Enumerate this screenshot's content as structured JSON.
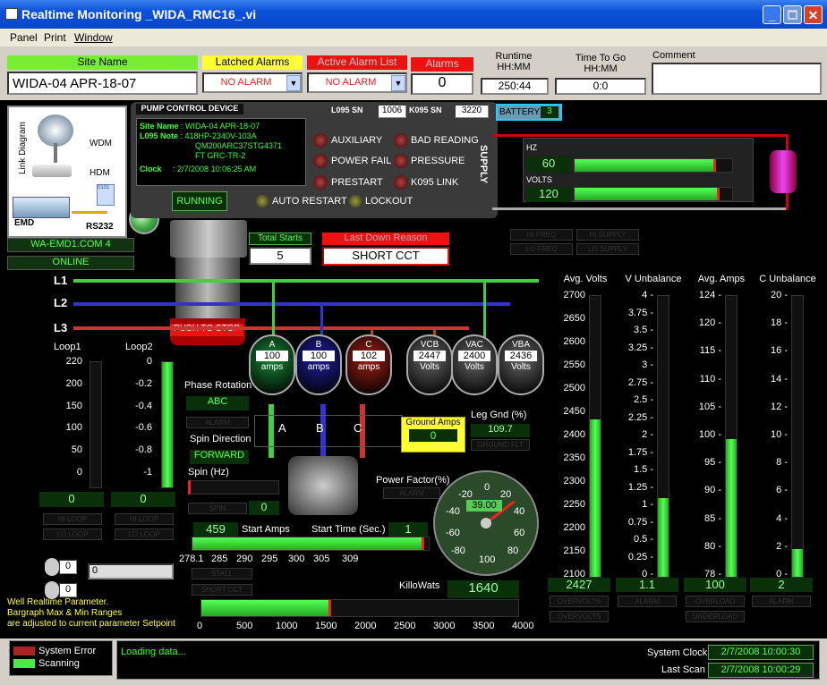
{
  "window": {
    "title": "Realtime Monitoring _WIDA_RMC16_.vi"
  },
  "menu": [
    "Panel",
    "Print",
    "Window"
  ],
  "top": {
    "site_name_label": "Site Name",
    "site_name_value": "WIDA-04    APR-18-07",
    "latched_alarms_label": "Latched Alarms",
    "latched_alarms_value": "NO ALARM",
    "active_alarm_label": "Active Alarm List",
    "active_alarm_value": "NO ALARM",
    "alarms_label": "Alarms",
    "alarms_value": "0",
    "runtime_label1": "Runtime",
    "runtime_label2": "HH:MM",
    "runtime_value": "250:44",
    "ttg_label1": "Time To Go",
    "ttg_label2": "HH:MM",
    "ttg_value": "0:0",
    "comment_label": "Comment",
    "comment_value": ""
  },
  "link": {
    "title": "Link Diagram",
    "wdm": "WDM",
    "hdm": "HDM",
    "emd": "EMD",
    "rs232": "RS232",
    "com": "WA-EMD1.COM 4",
    "status": "ONLINE"
  },
  "pcd": {
    "title": "PUMP CONTROL DEVICE",
    "l095_sn_label": "L095 SN",
    "l095_sn": "1006",
    "k095_sn_label": "K095 SN",
    "k095_sn": "3220",
    "battery_label": "BATTERY",
    "battery_value": "3",
    "site_name_label": "Site Name",
    "site_name": "WIDA-04   APR-18-07",
    "note_label": "L095 Note",
    "note": [
      "418HP-2340V-103A",
      "QM200ARC37STG4371",
      "FT GRC-TR-2"
    ],
    "clock_label": "Clock",
    "clock": "2/7/2008 10:06:25 AM",
    "indicators": [
      "AUXILIARY",
      "BAD READING",
      "POWER FAIL",
      "PRESSURE",
      "PRESTART",
      "K095 LINK"
    ],
    "supply": "SUPPLY",
    "running": "RUNNING",
    "auto_restart": "AUTO RESTART",
    "lockout": "LOCKOUT"
  },
  "supply": {
    "hz_label": "HZ",
    "hz": "60",
    "hz_frac": 0.9,
    "volts_label": "VOLTS",
    "volts": "120",
    "volts_frac": 0.92,
    "btns": [
      "HI FREQ",
      "HI SUPPLY",
      "LO FREQ",
      "LO SUPPLY"
    ]
  },
  "starts": {
    "total_label": "Total Starts",
    "total": "5",
    "down_label": "Last Down Reason",
    "down": "SHORT CCT",
    "push": "PUSH TO STOP"
  },
  "lines": [
    "L1",
    "L2",
    "L3"
  ],
  "meters": [
    {
      "name": "A",
      "value": "100",
      "unit": "amps",
      "color": "#1a8a3a"
    },
    {
      "name": "B",
      "value": "100",
      "unit": "amps",
      "color": "#2020a0"
    },
    {
      "name": "C",
      "value": "102",
      "unit": "amps",
      "color": "#a02018"
    },
    {
      "name": "VCB",
      "value": "2447",
      "unit": "Volts",
      "color": "#666"
    },
    {
      "name": "VAC",
      "value": "2400",
      "unit": "Volts",
      "color": "#666"
    },
    {
      "name": "VBA",
      "value": "2436",
      "unit": "Volts",
      "color": "#666"
    }
  ],
  "loops": {
    "loop1_label": "Loop1",
    "loop1_ticks": [
      "220",
      "200",
      "150",
      "100",
      "50",
      "0"
    ],
    "loop1_value": "0",
    "loop1_frac": 0,
    "loop2_label": "Loop2",
    "loop2_ticks": [
      "0",
      "-0.2",
      "-0.4",
      "-0.6",
      "-0.8",
      "-1"
    ],
    "loop2_value": "0",
    "loop2_frac": 1,
    "btns": [
      "HI LOOP",
      "HI LOOP",
      "LO LOOP",
      "LO LOOP"
    ]
  },
  "phase": {
    "rot_label": "Phase Rotation",
    "rot": "ABC",
    "alarm": "ALARM",
    "spin_dir_label": "Spin Direction",
    "spin_dir": "FORWARD",
    "spin_hz_label": "Spin (Hz)",
    "spin_btn": "SPIN",
    "spin_val": "0",
    "abc": [
      "A",
      "B",
      "C"
    ]
  },
  "ground": {
    "label": "Ground Amps",
    "value": "0",
    "leg_label": "Leg Gnd (%)",
    "leg": "109.7",
    "fault": "GROUND FLT"
  },
  "pf": {
    "label": "Power Factor(%)",
    "alarm": "ALARM",
    "value": "39.00",
    "ticks": [
      "-20",
      "0",
      "20",
      "-40",
      "40",
      "-60",
      "60",
      "-80",
      "80",
      "100",
      "100"
    ]
  },
  "start": {
    "amps": "459",
    "amps_label": "Start Amps",
    "time_label": "Start Time (Sec.)",
    "time": "1",
    "time_frac": 0.98,
    "ticks": [
      "278.1",
      "285",
      "290",
      "295",
      "300",
      "305",
      "309"
    ],
    "btns": [
      "STALL",
      "SHORT CCT"
    ]
  },
  "kw": {
    "label": "KilloWats",
    "value": "1640",
    "frac": 0.41,
    "ticks": [
      "0",
      "500",
      "1000",
      "1500",
      "2000",
      "2500",
      "3000",
      "3500",
      "4000"
    ]
  },
  "misc": {
    "num1": "0",
    "num2": "0",
    "text": "0",
    "note1": "Well Realtime Parameter.",
    "note2": "Bargraph Max & Min Ranges",
    "note3": "are adjusted to current parameter Setpoint"
  },
  "gauges": [
    {
      "title": "Avg. Volts",
      "ticks": [
        "2700",
        "2650",
        "2600",
        "2550",
        "2500",
        "2450",
        "2400",
        "2350",
        "2300",
        "2250",
        "2200",
        "2150",
        "2100"
      ],
      "value": "2427",
      "frac": 0.56,
      "btns": [
        "OVERVOLTS",
        "OVERVOLTS"
      ]
    },
    {
      "title": "V Unbalance",
      "ticks": [
        "4 -",
        "3.75 -",
        "3.5 -",
        "3.25 -",
        "3 -",
        "2.75 -",
        "2.5 -",
        "2.25 -",
        "2 -",
        "1.75 -",
        "1.5 -",
        "1.25 -",
        "1 -",
        "0.75 -",
        "0.5 -",
        "0.25 -",
        "0 -"
      ],
      "value": "1.1",
      "frac": 0.28,
      "btns": [
        "ALARM"
      ]
    },
    {
      "title": "Avg. Amps",
      "ticks": [
        "124 -",
        "120 -",
        "115 -",
        "110 -",
        "105 -",
        "100 -",
        "95 -",
        "90 -",
        "85 -",
        "80 -",
        "78 -"
      ],
      "value": "100",
      "frac": 0.49,
      "btns": [
        "OVERLOAD",
        "UNDERLOAD"
      ]
    },
    {
      "title": "C Unbalance",
      "ticks": [
        "20 -",
        "18 -",
        "16 -",
        "14 -",
        "12 -",
        "10 -",
        "8 -",
        "6 -",
        "4 -",
        "2 -",
        "0 -"
      ],
      "value": "2",
      "frac": 0.1,
      "btns": [
        "ALARM"
      ]
    }
  ],
  "status": {
    "sys_err": "System Error",
    "scanning": "Scanning",
    "log": "Loading data...",
    "sys_clock_label": "System Clock",
    "sys_clock": "2/7/2008 10:00:30",
    "last_scan_label": "Last Scan",
    "last_scan": "2/7/2008 10:00:29"
  },
  "colors": {
    "bar_green": "#33dd33",
    "alarm_red": "#ee1111",
    "label_yellow": "#ffff33",
    "site_green": "#77ee33"
  }
}
